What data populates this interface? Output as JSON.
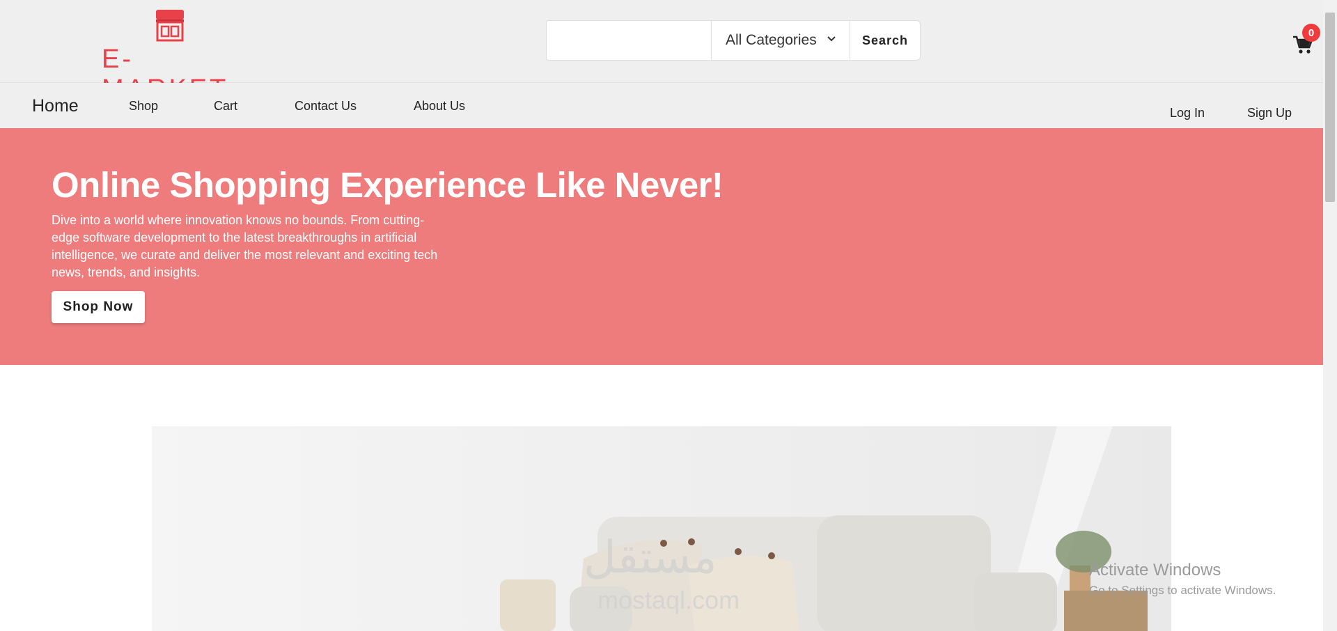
{
  "header": {
    "brand": "E-MARKET",
    "search": {
      "value": "",
      "placeholder": ""
    },
    "category": "All Categories",
    "search_label": "Search",
    "cart_count": "0"
  },
  "nav": {
    "items": [
      {
        "label": "Home"
      },
      {
        "label": "Shop"
      },
      {
        "label": "Cart"
      },
      {
        "label": "Contact Us"
      },
      {
        "label": "About Us"
      }
    ],
    "login": "Log In",
    "signup": "Sign Up"
  },
  "hero": {
    "title": "Online Shopping Experience Like Never!",
    "description": "Dive into a world where innovation knows no bounds. From cutting-edge software development to the latest breakthroughs in artificial intelligence, we curate and deliver the most relevant and exciting tech news, trends, and insights.",
    "button": "Shop Now"
  },
  "overlay": {
    "watermark_ar": "مستقل",
    "watermark_en": "mostaql.com",
    "windows_title": "Activate Windows",
    "windows_sub": "Go to Settings to activate Windows."
  },
  "colors": {
    "hero_bg": "#ef7c7c",
    "brand_red": "#e8414a",
    "badge_red": "#ef3b3b",
    "header_bg": "#efefef"
  },
  "icons": [
    "store-icon",
    "chevron-down-icon",
    "cart-icon"
  ]
}
